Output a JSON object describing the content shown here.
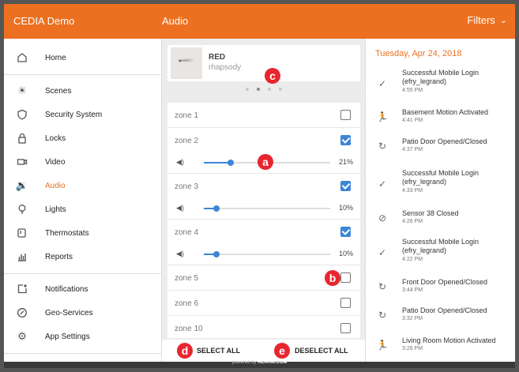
{
  "header": {
    "app_title": "CEDIA Demo",
    "section_title": "Audio",
    "filters_label": "Filters",
    "filters_icon": "chevron-down-icon"
  },
  "sidebar": {
    "items": [
      {
        "label": "Home",
        "icon": "home-icon"
      },
      {
        "label": "Scenes",
        "icon": "scenes-icon"
      },
      {
        "label": "Security System",
        "icon": "shield-icon"
      },
      {
        "label": "Locks",
        "icon": "lock-icon"
      },
      {
        "label": "Video",
        "icon": "video-camera-icon"
      },
      {
        "label": "Audio",
        "icon": "speaker-icon",
        "active": true
      },
      {
        "label": "Lights",
        "icon": "lightbulb-icon"
      },
      {
        "label": "Thermostats",
        "icon": "thermostat-icon"
      },
      {
        "label": "Reports",
        "icon": "bar-chart-icon"
      },
      {
        "label": "Notifications",
        "icon": "notification-icon"
      },
      {
        "label": "Geo-Services",
        "icon": "compass-icon"
      },
      {
        "label": "App Settings",
        "icon": "gear-icon"
      }
    ]
  },
  "now_playing": {
    "track": "RED",
    "artist": "rhapsody"
  },
  "pager": {
    "count": 4,
    "active_index": 1
  },
  "zones": [
    {
      "name": "zone 1",
      "checked": false
    },
    {
      "name": "zone 2",
      "checked": true,
      "volume": "21%",
      "volume_level": 0.21
    },
    {
      "name": "zone 3",
      "checked": true,
      "volume": "10%",
      "volume_level": 0.1
    },
    {
      "name": "zone 4",
      "checked": true,
      "volume": "10%",
      "volume_level": 0.1
    },
    {
      "name": "zone 5",
      "checked": false
    },
    {
      "name": "zone 6",
      "checked": false
    },
    {
      "name": "zone 10",
      "checked": false
    }
  ],
  "actions": {
    "select_all": "SELECT ALL",
    "deselect_all": "DESELECT ALL"
  },
  "callouts": {
    "a": "a",
    "b": "b",
    "c": "c",
    "d": "d",
    "e": "e"
  },
  "activity": {
    "date": "Tuesday, Apr 24, 2018",
    "events": [
      {
        "title": "Successful Mobile Login (efry_legrand)",
        "time": "4:55 PM",
        "icon": "checkmark-icon"
      },
      {
        "title": "Basement Motion Activated",
        "time": "4:41 PM",
        "icon": "motion-icon"
      },
      {
        "title": "Patio Door Opened/Closed",
        "time": "4:37 PM",
        "icon": "door-sensor-icon"
      },
      {
        "title": "Successful Mobile Login (efry_legrand)",
        "time": "4:33 PM",
        "icon": "checkmark-icon"
      },
      {
        "title": "Sensor 38 Closed",
        "time": "4:26 PM",
        "icon": "sensor-closed-icon"
      },
      {
        "title": "Successful Mobile Login (efry_legrand)",
        "time": "4:22 PM",
        "icon": "checkmark-icon"
      },
      {
        "title": "Front Door Opened/Closed",
        "time": "3:44 PM",
        "icon": "door-sensor-icon"
      },
      {
        "title": "Patio Door Opened/Closed",
        "time": "3:32 PM",
        "icon": "door-sensor-icon"
      },
      {
        "title": "Living Room Motion Activated",
        "time": "3:26 PM",
        "icon": "motion-icon"
      }
    ]
  },
  "footer": {
    "powered_by": "powered by",
    "brand": "ALARM.COM"
  },
  "colors": {
    "accent": "#ec7020",
    "checkbox": "#3b86d6",
    "callout": "#e8262f"
  }
}
